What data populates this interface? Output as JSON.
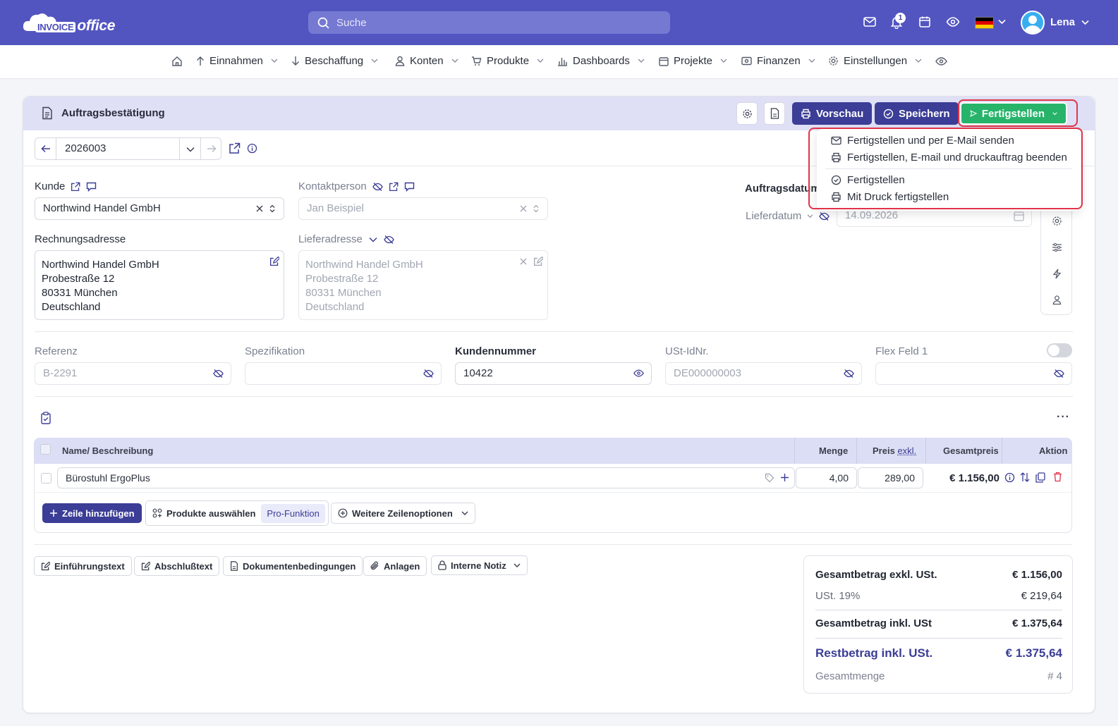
{
  "app": {
    "logo_word1": "INVOICE",
    "logo_word2": "office",
    "search_placeholder": "Suche",
    "notification_count": "1",
    "user_name": "Lena",
    "accent_color": "#5255c0",
    "icons": [
      "mail-icon",
      "bell-icon",
      "calendar-icon",
      "eye-icon",
      "flag-de-icon",
      "chevron-down-icon",
      "avatar-icon"
    ]
  },
  "nav": {
    "items": [
      {
        "label": "Einnahmen",
        "icon": "arrow-up-icon"
      },
      {
        "label": "Beschaffung",
        "icon": "arrow-down-icon"
      },
      {
        "label": "Konten",
        "icon": "user-icon"
      },
      {
        "label": "Produkte",
        "icon": "cart-icon"
      },
      {
        "label": "Dashboards",
        "icon": "bar-chart-icon"
      },
      {
        "label": "Projekte",
        "icon": "calendar-icon"
      },
      {
        "label": "Finanzen",
        "icon": "money-icon"
      },
      {
        "label": "Einstellungen",
        "icon": "gear-icon"
      }
    ]
  },
  "doc": {
    "title": "Auftragsbestätigung",
    "preview_label": "Vorschau",
    "save_label": "Speichern",
    "finish_label": "Fertigstellen",
    "finish_menu": [
      {
        "label": "Fertigstellen und per E-Mail senden",
        "icon": "mail-icon"
      },
      {
        "label": "Fertigstellen, E-mail und druckauftrag beenden",
        "icon": "printer-icon"
      },
      {
        "label": "Fertigstellen",
        "icon": "check-circle-icon"
      },
      {
        "label": "Mit Druck fertigstellen",
        "icon": "printer-icon"
      }
    ],
    "number": "2026003"
  },
  "form": {
    "customer_label": "Kunde",
    "customer_value": "Northwind Handel GmbH",
    "contact_label": "Kontaktperson",
    "contact_value": "Jan Beispiel",
    "order_date_label": "Auftragsdatum",
    "delivery_date_label": "Lieferdatum",
    "delivery_date_value": "14.09.2026",
    "billing_label": "Rechnungsadresse",
    "billing": [
      "Northwind Handel GmbH",
      "Probestraße 12",
      "80331 München",
      "Deutschland"
    ],
    "shipping_label": "Lieferadresse",
    "shipping": [
      "Northwind Handel GmbH",
      "Probestraße 12",
      "80331 München",
      "Deutschland"
    ],
    "reference_label": "Referenz",
    "reference_placeholder": "B-2291",
    "spec_label": "Spezifikation",
    "customer_no_label": "Kundennummer",
    "customer_no_value": "10422",
    "vat_label": "USt-IdNr.",
    "vat_placeholder": "DE000000003",
    "flex_label": "Flex Feld 1"
  },
  "table": {
    "headers": {
      "name": "Name/ Beschreibung",
      "qty": "Menge",
      "price": "Preis",
      "price_suffix": "exkl.",
      "total": "Gesamtpreis",
      "action": "Aktion"
    },
    "rows": [
      {
        "name": "Bürostuhl ErgoPlus",
        "qty": "4,00",
        "price": "289,00",
        "total": "€ 1.156,00"
      }
    ],
    "add_row_label": "Zeile hinzufügen",
    "select_products_label": "Produkte auswählen",
    "pro_badge": "Pro-Funktion",
    "more_options_label": "Weitere Zeilenoptionen"
  },
  "footer_buttons": {
    "intro": "Einführungstext",
    "closing": "Abschlußtext",
    "terms": "Dokumentenbedingungen",
    "attachments": "Anlagen",
    "internal_note": "Interne Notiz"
  },
  "totals": {
    "net_label": "Gesamtbetrag exkl. USt.",
    "net_value": "€ 1.156,00",
    "vat_label": "USt. 19%",
    "vat_value": "€ 219,64",
    "gross_label": "Gesamtbetrag inkl. USt",
    "gross_value": "€ 1.375,64",
    "remaining_label": "Restbetrag inkl. USt.",
    "remaining_value": "€ 1.375,64",
    "quantity_label": "Gesamtmenge",
    "quantity_value": "# 4"
  }
}
